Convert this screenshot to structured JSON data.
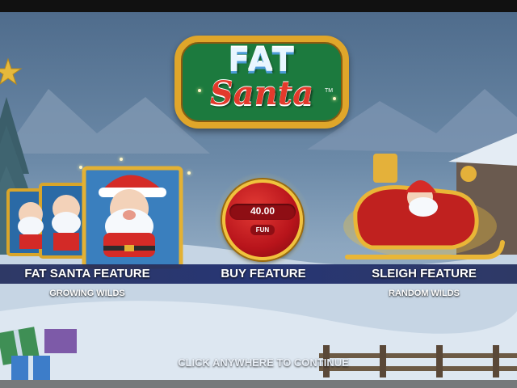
{
  "logo": {
    "line1": "FAT",
    "line2": "Santa",
    "trademark": "TM"
  },
  "features": [
    {
      "title": "FAT SANTA FEATURE",
      "subtitle": "GROWING WILDS"
    },
    {
      "title": "BUY FEATURE",
      "subtitle": ""
    },
    {
      "title": "SLEIGH FEATURE",
      "subtitle": "RANDOM WILDS"
    }
  ],
  "buy": {
    "amount": "40.00",
    "currency": "FUN"
  },
  "prompt": "CLICK ANYWHERE TO CONTINUE",
  "icons": [
    "santa-symbol-icon",
    "sleigh-icon",
    "star-icon",
    "gift-icon"
  ],
  "colors": {
    "feature_bar": "#1e2d6e",
    "coin_red": "#c1161d",
    "gold": "#f1c23d",
    "logo_green": "#1c7a3e"
  }
}
